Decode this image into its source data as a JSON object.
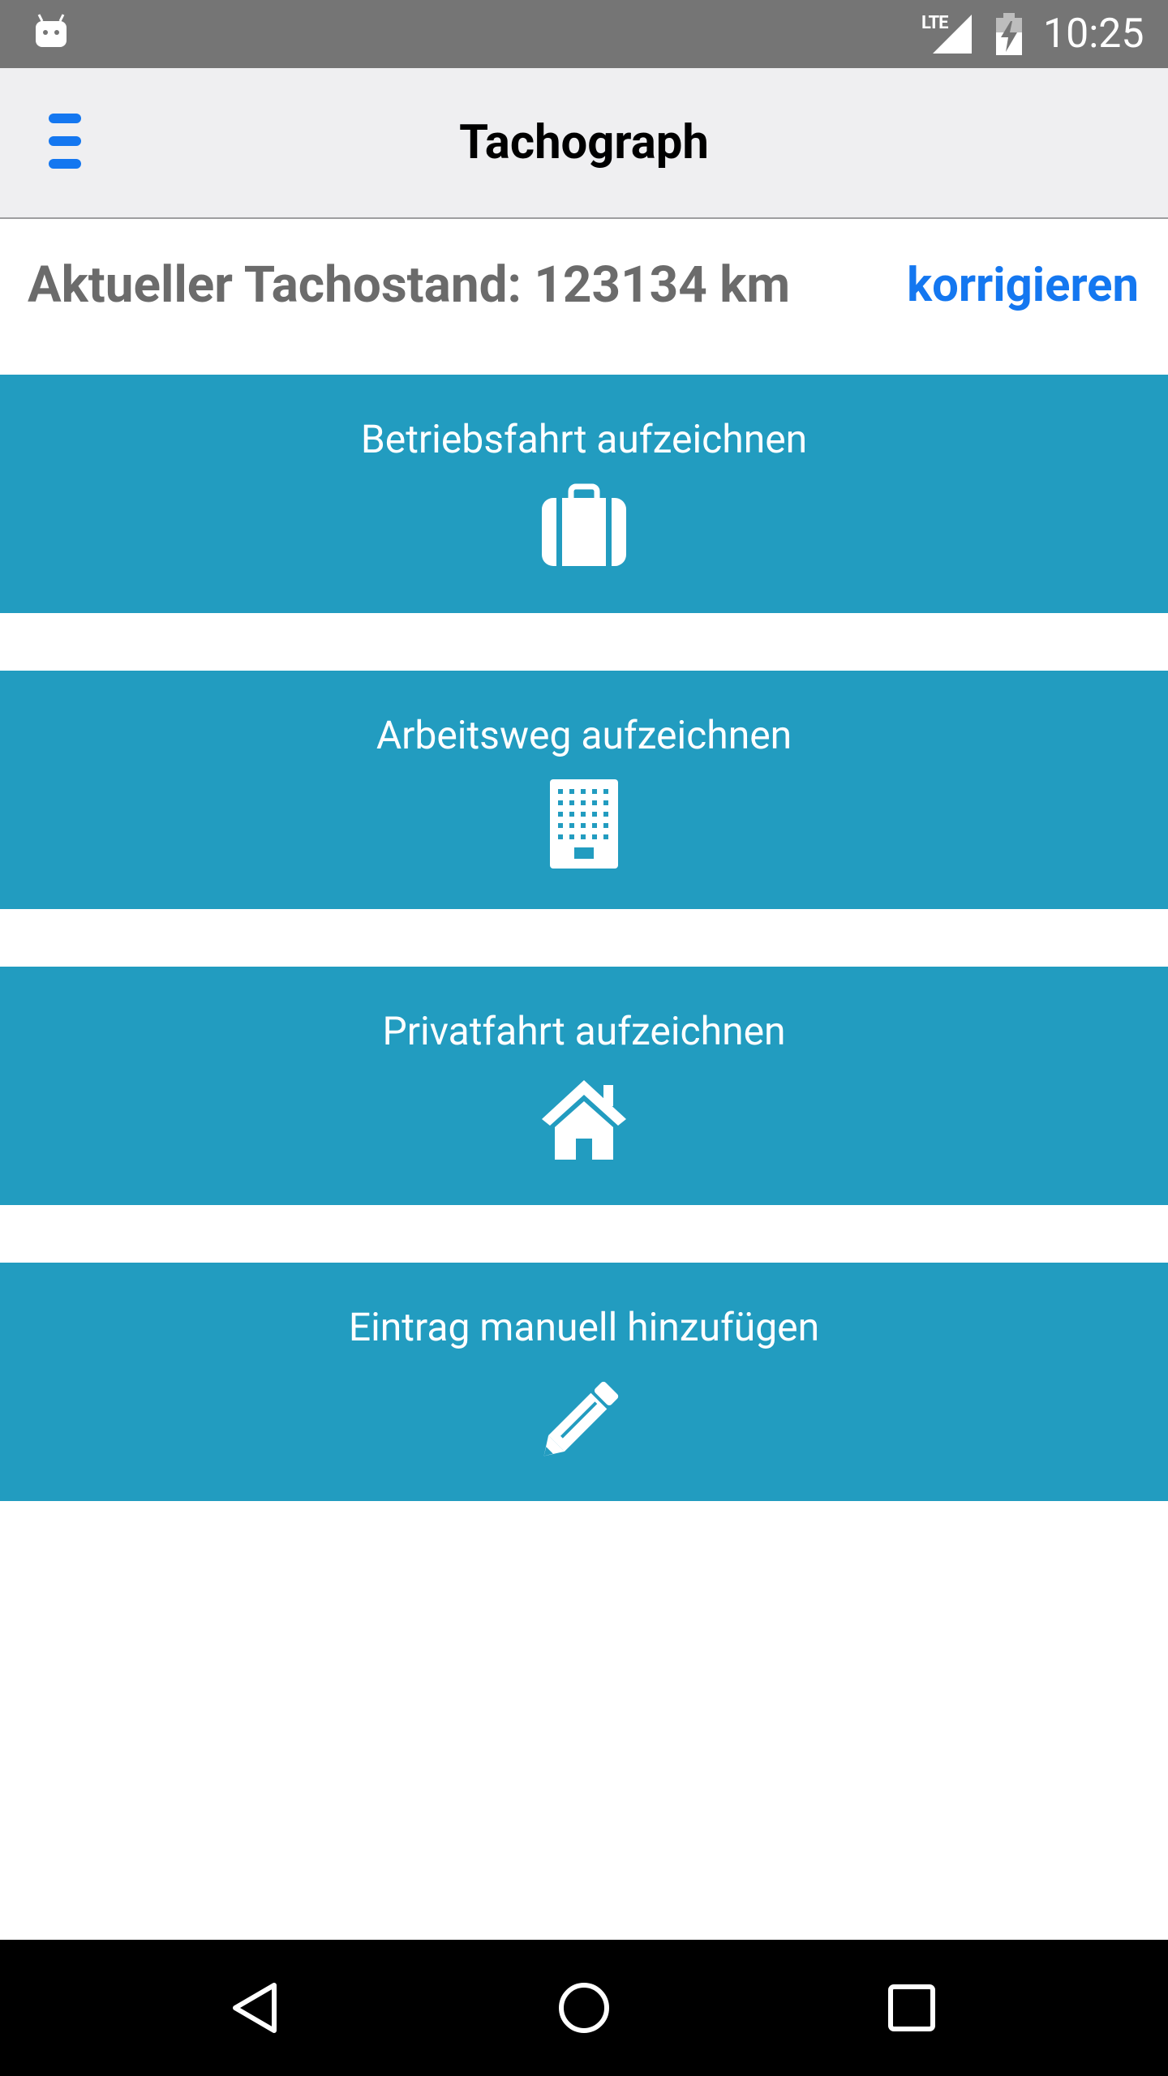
{
  "status_bar": {
    "network_label": "LTE",
    "time": "10:25"
  },
  "app_bar": {
    "title": "Tachograph",
    "menu_icon": "menu-icon",
    "menu_color": "#1477f0"
  },
  "odometer": {
    "label": "Aktueller Tachostand: 123134 km",
    "correct_link": "korrigieren"
  },
  "actions": [
    {
      "label": "Betriebsfahrt aufzeichnen",
      "icon": "briefcase-icon"
    },
    {
      "label": "Arbeitsweg aufzeichnen",
      "icon": "office-building-icon"
    },
    {
      "label": "Privatfahrt aufzeichnen",
      "icon": "home-icon"
    },
    {
      "label": "Eintrag manuell hinzufügen",
      "icon": "pencil-icon"
    }
  ],
  "colors": {
    "action_bg": "#229cc0",
    "accent": "#1477f0",
    "status_bar": "#757575",
    "app_bar": "#efeff1"
  },
  "nav_bar": {
    "icons": [
      "back-icon",
      "home-circle-icon",
      "recents-icon"
    ]
  }
}
